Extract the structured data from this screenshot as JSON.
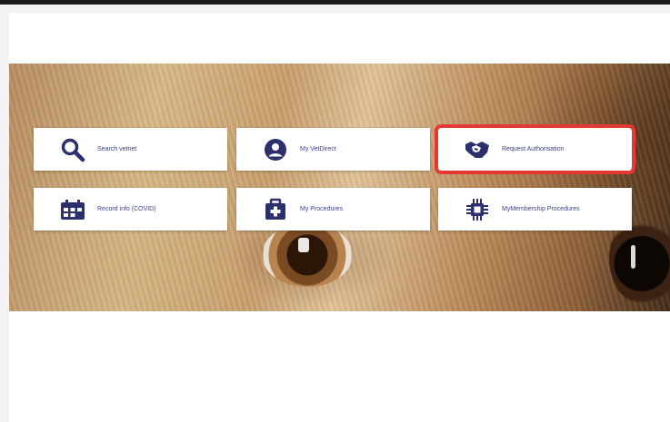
{
  "colors": {
    "icon": "#2b2f6b",
    "label": "#3a3f8a",
    "highlight": "#e53935"
  },
  "tiles": [
    {
      "label": "Search vetnet",
      "icon": "search-icon"
    },
    {
      "label": "My VetDirect",
      "icon": "user-circle-icon"
    },
    {
      "label": "Request Authorisation",
      "icon": "handshake-icon"
    },
    {
      "label": "Record info (COVID)",
      "icon": "calendar-icon"
    },
    {
      "label": "My Procedures",
      "icon": "medical-bag-icon"
    },
    {
      "label": "MyMembership Procedures",
      "icon": "chip-icon"
    }
  ]
}
